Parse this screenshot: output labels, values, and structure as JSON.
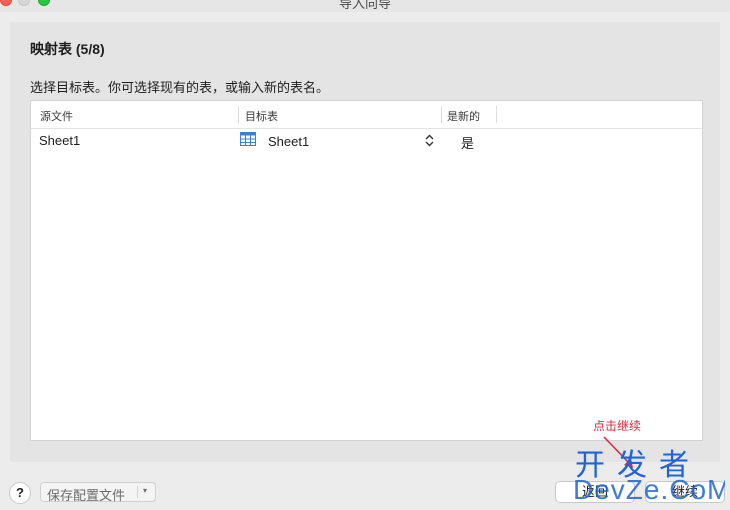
{
  "window": {
    "title": "导入向导"
  },
  "step": {
    "title": "映射表 (5/8)",
    "instruction": "选择目标表。你可选择现有的表，或输入新的表名。"
  },
  "table": {
    "headers": {
      "source": "源文件",
      "target": "目标表",
      "is_new": "是新的"
    },
    "rows": [
      {
        "source": "Sheet1",
        "target": "Sheet1",
        "is_new": "是"
      }
    ]
  },
  "annotation": {
    "text": "点击继续"
  },
  "footer": {
    "help_label": "?",
    "save_config_label": "保存配置文件",
    "save_config_caret": "▾",
    "back_label": "返回",
    "next_label": "继续"
  },
  "watermark": {
    "top_text": "开发者",
    "bottom_text": "DevZe.CoM"
  },
  "colors": {
    "annotation": "#e0283c",
    "watermark": "#1e64d6",
    "close": "#ff5f57",
    "zoom": "#28c840"
  },
  "icons": {
    "table": "table-icon",
    "stepper": "updown-chevron-icon",
    "help": "question-icon"
  }
}
